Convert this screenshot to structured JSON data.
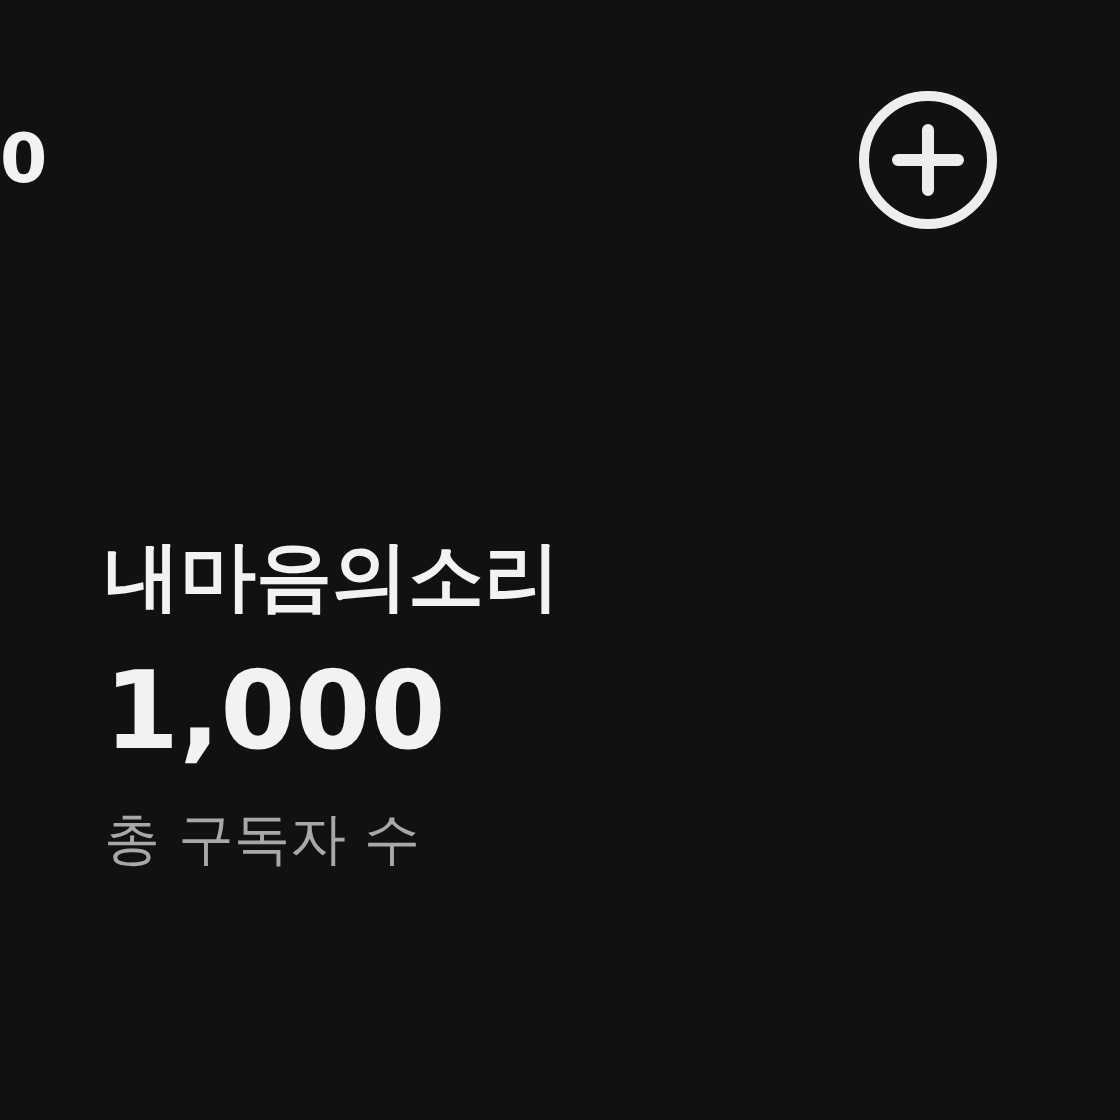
{
  "header": {
    "partial_text": "0"
  },
  "channel": {
    "name": "내마음의소리",
    "subscriber_count": "1,000",
    "subscriber_label": "총 구독자 수"
  }
}
